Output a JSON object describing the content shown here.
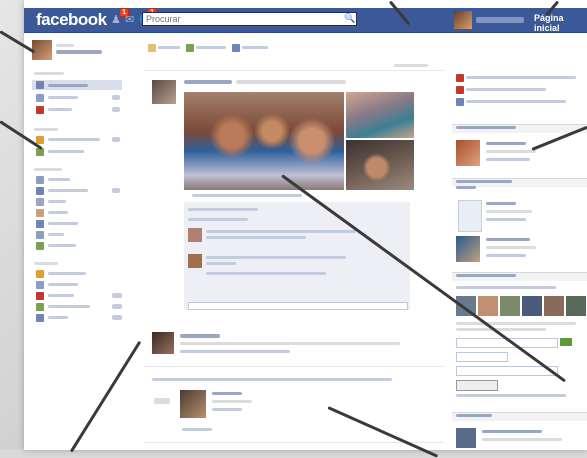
{
  "topbar": {
    "logo": "facebook",
    "notifications": {
      "friends_count": "1",
      "messages_count": "",
      "notifications_count": "1"
    },
    "search_placeholder": "Procurar",
    "home_label": "Página inicial"
  },
  "colors": {
    "brand_blue": "#3b5998",
    "badge_red": "#f03d25",
    "callout_line": "#3a3a3a"
  }
}
